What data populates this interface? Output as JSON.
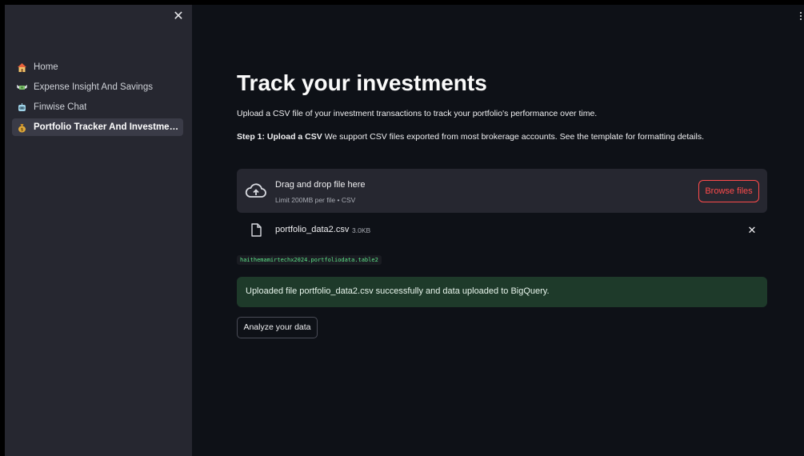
{
  "sidebar": {
    "items": [
      {
        "label": "Home",
        "icon": "house-icon",
        "active": false
      },
      {
        "label": "Expense Insight And Savings",
        "icon": "money-wings-icon",
        "active": false
      },
      {
        "label": "Finwise Chat",
        "icon": "robot-icon",
        "active": false
      },
      {
        "label": "Portfolio Tracker And Investment In...",
        "icon": "money-bag-icon",
        "active": true
      }
    ]
  },
  "main": {
    "title": "Track your investments",
    "intro": "Upload a CSV file of your investment transactions to track your portfolio's performance over time.",
    "step_label": "Step 1: Upload a CSV",
    "step_text": " We support CSV files exported from most brokerage accounts. See the template for formatting details.",
    "uploader": {
      "drag_text": "Drag and drop file here",
      "limit_text": "Limit 200MB per file • CSV",
      "browse_label": "Browse files"
    },
    "file": {
      "name": "portfolio_data2.csv",
      "size": "3.0KB"
    },
    "table_id": "haithemamirtechx2024.portfoliodata.table2",
    "success_message": "Uploaded file portfolio_data2.csv successfully and data uploaded to BigQuery.",
    "analyze_label": "Analyze your data"
  },
  "colors": {
    "background": "#0e1117",
    "sidebar": "#262730",
    "accent": "#ff4b4b",
    "success_bg": "#1e3a2a",
    "code_text": "#5ce488"
  }
}
